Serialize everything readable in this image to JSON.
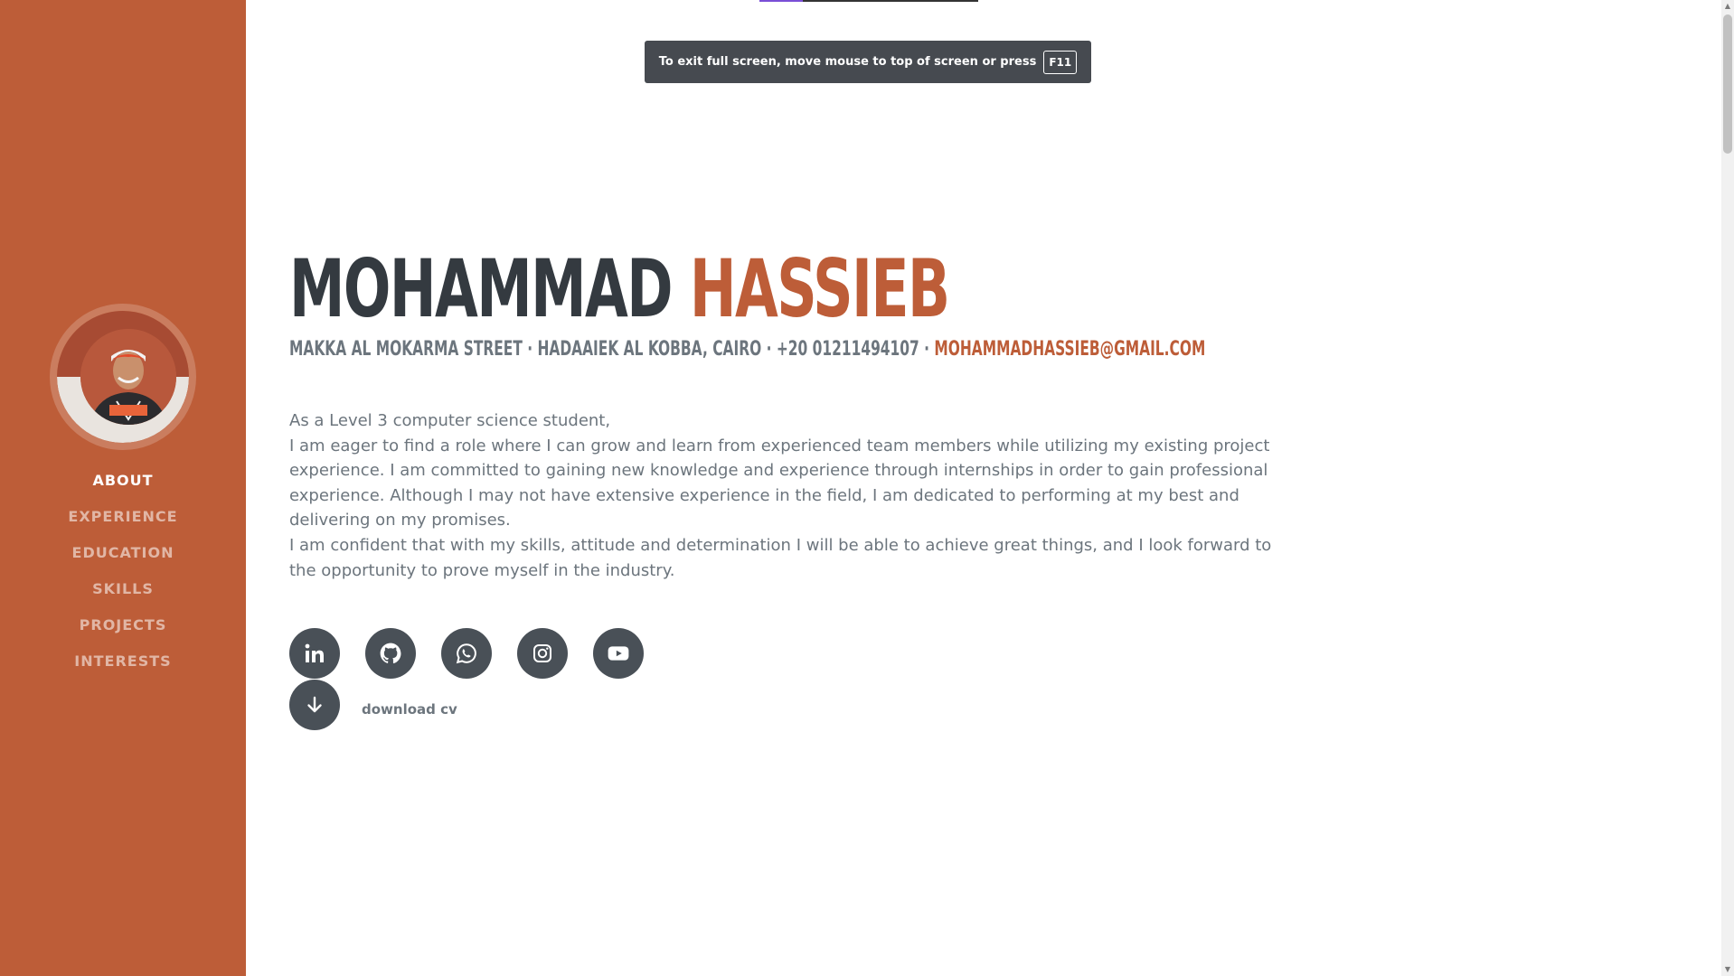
{
  "sidebar": {
    "nav": [
      {
        "label": "ABOUT",
        "active": true
      },
      {
        "label": "EXPERIENCE"
      },
      {
        "label": "EDUCATION"
      },
      {
        "label": "SKILLS"
      },
      {
        "label": "PROJECTS"
      },
      {
        "label": "INTERESTS"
      }
    ],
    "accent": "#bd5d38"
  },
  "notice": {
    "text": "To exit full screen, move mouse to top of screen or press",
    "key": "F11"
  },
  "header": {
    "first_name": "MOHAMMAD",
    "last_name": "HASSIEB",
    "address": "MAKKA AL MOKARMA STREET · HADAAIEK AL KOBBA, CAIRO · +20 01211494107 ·",
    "email": "MOHAMMADHASSIEB@GMAIL.COM"
  },
  "about": {
    "line1": "As a Level 3 computer science student,",
    "line2": "I am eager to find a role where I can grow and learn from experienced team members while utilizing my existing project experience. I am committed to gaining new knowledge and experience through internships in order to gain professional experience. Although I may not have extensive experience in the field, I am dedicated to performing at my best and delivering on my promises.",
    "line3": "I am confident that with my skills, attitude and determination I will be able to achieve great things, and I look forward to the opportunity to prove myself in the industry."
  },
  "social": {
    "icons": [
      "linkedin-icon",
      "github-icon",
      "whatsapp-icon",
      "instagram-icon",
      "youtube-icon"
    ],
    "download_label": "download cv"
  }
}
